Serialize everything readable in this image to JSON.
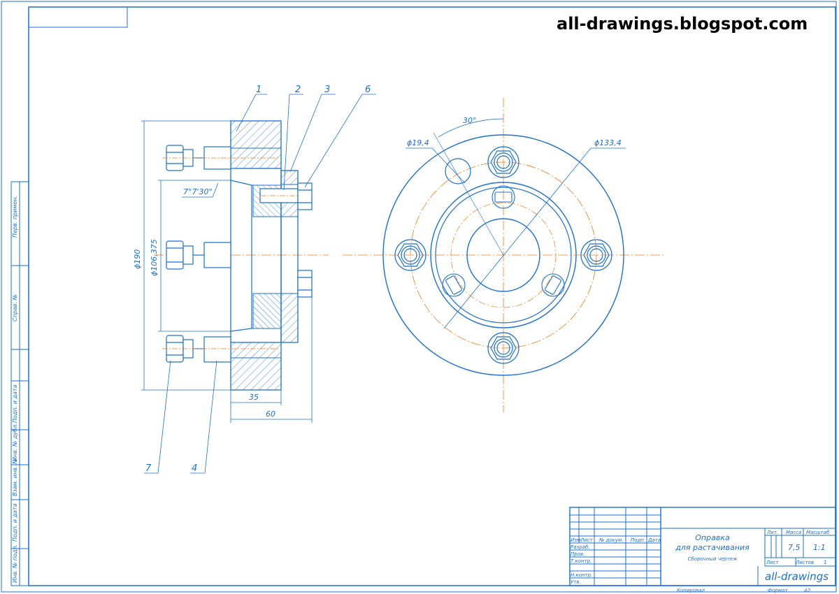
{
  "watermark": "all-drawings.blogspot.com",
  "colors": {
    "line": "#1b6fd6",
    "axis": "#f07c16",
    "hatch": "#1b6fd6",
    "paper": "#ffffff"
  },
  "side_margin_labels": [
    "Перв. примен.",
    "Справ. №",
    "Подп. и дата",
    "Инв. № дубл.",
    "Взам. инв. №",
    "Подп. и дата",
    "Инв. № подл."
  ],
  "callouts": {
    "p1": "1",
    "p2": "2",
    "p3": "3",
    "p4": "4",
    "p6": "6",
    "p7": "7"
  },
  "dimensions": {
    "d190": "ϕ190",
    "d106": "ϕ106,375",
    "w35": "35",
    "w60": "60",
    "taper": "7°7'30\"",
    "angle30": "30°",
    "hole": "ϕ19,4",
    "pcd": "ϕ133,4"
  },
  "title_block": {
    "title_line1": "Оправка",
    "title_line2": "для растачивания",
    "doc_type": "Сборочный чертеж",
    "col_izm": "Изм.",
    "col_list": "Лист",
    "col_docnum": "№ докум.",
    "col_sign": "Подп.",
    "col_date": "Дата",
    "row_razrab": "Разраб.",
    "row_prov": "Пров.",
    "row_tkontr": "Т.контр.",
    "row_nkontr": "Н.контр.",
    "row_utv": "Утв.",
    "lit_label": "Лит.",
    "mass_label": "Масса",
    "scale_label": "Масштаб",
    "mass_value": "7,5",
    "scale_value": "1:1",
    "sheet_label": "Лист",
    "sheets_label": "Листов",
    "sheets_value": "1",
    "company": "all-drawings",
    "copied": "Копировал",
    "format": "Формат",
    "format_value": "А2"
  }
}
